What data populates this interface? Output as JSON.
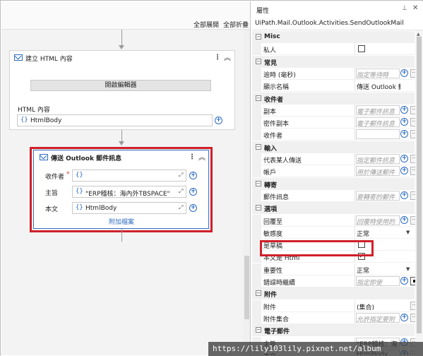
{
  "designer": {
    "expand_all": "全部展開",
    "collapse_all": "全部折疊",
    "build_html": {
      "title": "建立 HTML 內容",
      "open_editor": "開啟編輯器",
      "html_content_label": "HTML 內容",
      "html_content_value": "HtmlBody"
    },
    "send_mail": {
      "title": "傳送 Outlook 郵件訊息",
      "to_label": "收件者",
      "required_mark": "*",
      "to_value": "",
      "subject_label": "主旨",
      "subject_value": "\"ERP稽核：海內外TBSPACE\"",
      "body_label": "本文",
      "body_value": "HtmlBody",
      "attach_link": "附加檔案"
    }
  },
  "properties": {
    "title": "屬性",
    "class_name": "UiPath.Mail.Outlook.Activities.SendOutlookMail",
    "rows": [
      {
        "type": "category",
        "label": "Misc",
        "toggle": "−"
      },
      {
        "type": "prop",
        "name": "私人",
        "kind": "check",
        "checked": false
      },
      {
        "type": "category",
        "label": "常見",
        "toggle": "−"
      },
      {
        "type": "prop",
        "name": "逾時 (毫秒)",
        "kind": "text",
        "value": "指定等待時",
        "placeholder": true,
        "plus": true,
        "more": true
      },
      {
        "type": "prop",
        "name": "顯示名稱",
        "kind": "text",
        "value": "傳送 Outlook 郵件訊息",
        "placeholder": false,
        "plus": false,
        "more": false
      },
      {
        "type": "category",
        "label": "收件者",
        "toggle": "−"
      },
      {
        "type": "prop",
        "name": "副本",
        "kind": "text",
        "value": "電子郵件訊息",
        "placeholder": true,
        "plus": true,
        "more": true
      },
      {
        "type": "prop",
        "name": "密件副本",
        "kind": "text",
        "value": "電子郵件訊息",
        "placeholder": true,
        "plus": true,
        "more": true
      },
      {
        "type": "prop",
        "name": "收件者",
        "kind": "text",
        "value": "",
        "placeholder": false,
        "plus": true,
        "more": true
      },
      {
        "type": "category",
        "label": "輸入",
        "toggle": "−"
      },
      {
        "type": "prop",
        "name": "代表某人傳送",
        "kind": "text",
        "value": "指定郵件訊息",
        "placeholder": true,
        "plus": true,
        "more": true
      },
      {
        "type": "prop",
        "name": "帳戶",
        "kind": "text",
        "value": "用於傳送郵件",
        "placeholder": true,
        "plus": true,
        "more": true
      },
      {
        "type": "category",
        "label": "轉寄",
        "toggle": "−"
      },
      {
        "type": "prop",
        "name": "郵件訊息",
        "kind": "text",
        "value": "要轉寄的郵件",
        "placeholder": true,
        "plus": true,
        "more": true
      },
      {
        "type": "category",
        "label": "選項",
        "toggle": "−"
      },
      {
        "type": "prop",
        "name": "回覆至",
        "kind": "text",
        "value": "回覆時使用的",
        "placeholder": true,
        "plus": true,
        "more": true
      },
      {
        "type": "prop",
        "name": "敏感度",
        "kind": "select",
        "value": "正常"
      },
      {
        "type": "prop",
        "name": "是草稿",
        "kind": "check",
        "checked": false
      },
      {
        "type": "prop",
        "name": "本文是 Html",
        "kind": "check",
        "checked": true
      },
      {
        "type": "prop",
        "name": "重要性",
        "kind": "select",
        "value": "正常"
      },
      {
        "type": "prop",
        "name": "錯誤時繼續",
        "kind": "text",
        "value": "指定即使",
        "placeholder": true,
        "plus": true,
        "swatch": true
      },
      {
        "type": "category",
        "label": "附件",
        "toggle": "−"
      },
      {
        "type": "prop",
        "name": "附件",
        "kind": "text",
        "value": "(集合)",
        "placeholder": false,
        "plus": false,
        "more": true
      },
      {
        "type": "prop",
        "name": "附件集合",
        "kind": "text",
        "value": "允許指定要附",
        "placeholder": true,
        "plus": true,
        "more": true
      },
      {
        "type": "category",
        "label": "電子郵件",
        "toggle": "−"
      },
      {
        "type": "prop",
        "name": "主旨",
        "kind": "text",
        "value": "\"ERP稽核：海",
        "placeholder": false,
        "plus": true,
        "more": true
      },
      {
        "type": "prop",
        "name": "本文",
        "kind": "text",
        "value": "HtmlBody",
        "placeholder": false,
        "plus": true,
        "more": true
      }
    ]
  },
  "watermark": "https://lily103lily.pixnet.net/album",
  "colors": {
    "accent": "#2e6cc0",
    "highlight": "#d02029"
  }
}
